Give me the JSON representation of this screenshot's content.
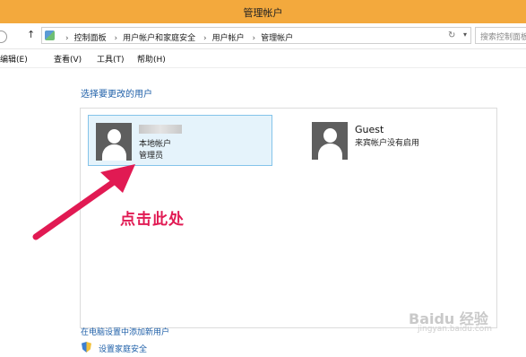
{
  "window": {
    "title": "管理帐户"
  },
  "address": {
    "crumbs": [
      "控制面板",
      "用户帐户和家庭安全",
      "用户帐户",
      "管理帐户"
    ],
    "search_placeholder": "搜索控制面板"
  },
  "menu": {
    "items": [
      "编辑(E)",
      "查看(V)",
      "工具(T)",
      "帮助(H)"
    ]
  },
  "main": {
    "heading": "选择要更改的用户",
    "users": [
      {
        "name": "",
        "type": "本地帐户",
        "role": "管理员",
        "selected": true
      },
      {
        "name": "Guest",
        "type": "来宾帐户没有启用",
        "role": "",
        "selected": false
      }
    ],
    "annotation": "点击此处",
    "links": {
      "add_user": "在电脑设置中添加新用户",
      "family_safety": "设置家庭安全"
    },
    "watermark": {
      "text": "Baidu 经验",
      "sub": "jingyan.baidu.com"
    }
  },
  "colors": {
    "titlebar": "#f3a93d",
    "accent_link": "#1e5fa8",
    "selected_bg": "#e5f3fb",
    "annotation": "#e11a53"
  }
}
